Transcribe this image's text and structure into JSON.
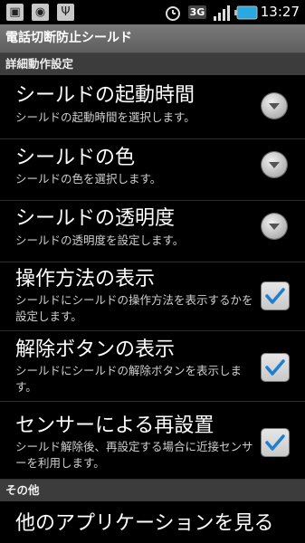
{
  "status_bar": {
    "time": "13:27",
    "network": "3G",
    "icons": [
      "lock-screen-icon",
      "android-debug-icon",
      "usb-icon",
      "alarm-icon",
      "network-3g-icon",
      "signal-icon",
      "battery-icon"
    ]
  },
  "app_title": "電話切断防止シールド",
  "sections": {
    "detail": "詳細動作設定",
    "other": "その他"
  },
  "settings": [
    {
      "title": "シールドの起動時間",
      "summary": "シールドの起動時間を選択します。",
      "control": "dropdown"
    },
    {
      "title": "シールドの色",
      "summary": "シールドの色を選択します。",
      "control": "dropdown"
    },
    {
      "title": "シールドの透明度",
      "summary": "シールドの透明度を設定します。",
      "control": "dropdown"
    },
    {
      "title": "操作方法の表示",
      "summary": "シールドにシールドの操作方法を表示するかを設定します。",
      "control": "checkbox",
      "checked": true
    },
    {
      "title": "解除ボタンの表示",
      "summary": "シールドにシールドの解除ボタンを表示します。",
      "control": "checkbox",
      "checked": true
    },
    {
      "title": "センサーによる再設置",
      "summary": "シールド解除後、再設定する場合に近接センサーを利用します。",
      "control": "checkbox",
      "checked": true
    }
  ],
  "other_items": [
    {
      "title": "他のアプリケーションを見る"
    }
  ],
  "colors": {
    "accent_check": "#1e7fd0",
    "battery": "#2aa8e0",
    "section_bg": "#3c3c3c",
    "title_bg": "#6c6c6c"
  }
}
